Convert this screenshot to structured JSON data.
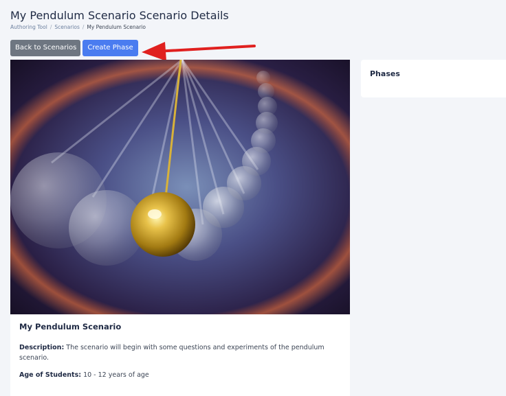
{
  "header": {
    "title": "My Pendulum Scenario Scenario Details",
    "breadcrumb": [
      "Authoring Tool",
      "Scenarios",
      "My Pendulum Scenario"
    ],
    "breadcrumb_separator": "/"
  },
  "toolbar": {
    "back_label": "Back to Scenarios",
    "create_label": "Create Phase"
  },
  "scenario": {
    "name": "My Pendulum Scenario",
    "description_label": "Description:",
    "description": "The scenario will begin with some questions and experiments of the pendulum scenario.",
    "age_label": "Age of Students:",
    "age": "10 - 12 years of age"
  },
  "phases": {
    "title": "Phases"
  },
  "colors": {
    "accent": "#4a7cf0",
    "secondary_button": "#6e7681",
    "annotation_arrow": "#e0201f",
    "background": "#f3f5f9"
  }
}
